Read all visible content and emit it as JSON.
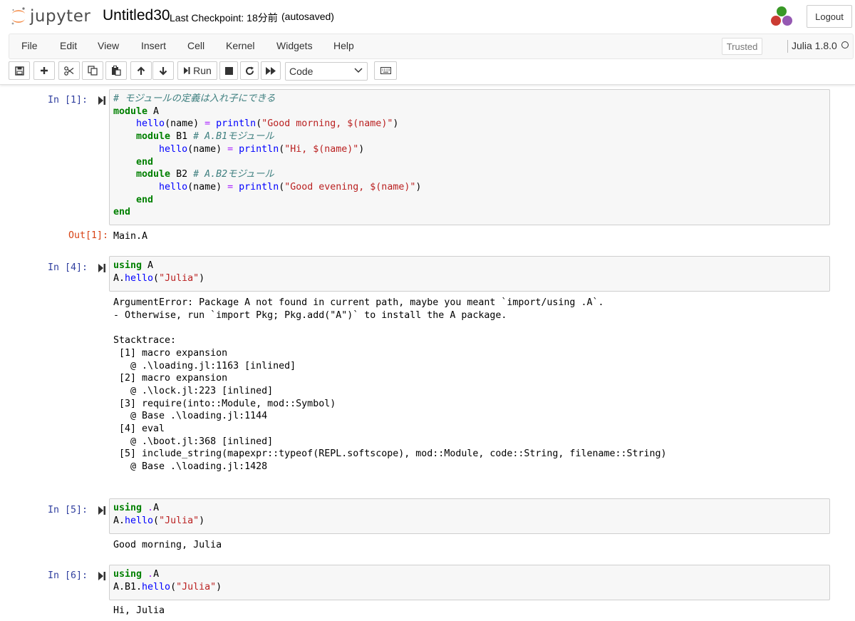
{
  "header": {
    "logo_text": "jupyter",
    "notebook_name": "Untitled30",
    "checkpoint": "Last Checkpoint: 18分前",
    "autosave": "(autosaved)",
    "logout_label": "Logout"
  },
  "menu": {
    "items": [
      "File",
      "Edit",
      "View",
      "Insert",
      "Cell",
      "Kernel",
      "Widgets",
      "Help"
    ],
    "trusted_label": "Trusted",
    "kernel_name": "Julia 1.8.0"
  },
  "toolbar": {
    "run_label": "Run",
    "cell_type": "Code",
    "buttons": [
      "save-icon",
      "plus-icon",
      "cut-icon",
      "copy-icon",
      "paste-icon",
      "arrow-up-icon",
      "arrow-down-icon",
      "run-icon",
      "stop-icon",
      "restart-icon",
      "fast-forward-icon",
      "keyboard-icon"
    ]
  },
  "cells": [
    {
      "prompt": "In [1]:",
      "code": [
        "# モジュールの定義は入れ子にできる",
        "module A",
        "    hello(name) = println(\"Good morning, $(name)\")",
        "    module B1 # A.B1モジュール",
        "        hello(name) = println(\"Hi, $(name)\")",
        "    end",
        "    module B2 # A.B2モジュール",
        "        hello(name) = println(\"Good evening, $(name)\")",
        "    end",
        "end"
      ],
      "out_prompt": "Out[1]:",
      "output": [
        "Main.A"
      ]
    },
    {
      "prompt": "In [4]:",
      "code": [
        "using A",
        "A.hello(\"Julia\")"
      ],
      "out_prompt": "",
      "output": [
        "ArgumentError: Package A not found in current path, maybe you meant `import/using .A`.",
        "- Otherwise, run `import Pkg; Pkg.add(\"A\")` to install the A package.",
        "",
        "Stacktrace:",
        " [1] macro expansion",
        "   @ .\\loading.jl:1163 [inlined]",
        " [2] macro expansion",
        "   @ .\\lock.jl:223 [inlined]",
        " [3] require(into::Module, mod::Symbol)",
        "   @ Base .\\loading.jl:1144",
        " [4] eval",
        "   @ .\\boot.jl:368 [inlined]",
        " [5] include_string(mapexpr::typeof(REPL.softscope), mod::Module, code::String, filename::String)",
        "   @ Base .\\loading.jl:1428"
      ]
    },
    {
      "prompt": "In [5]:",
      "code": [
        "using .A",
        "A.hello(\"Julia\")"
      ],
      "out_prompt": "",
      "output": [
        "Good morning, Julia"
      ]
    },
    {
      "prompt": "In [6]:",
      "code": [
        "using .A",
        "A.B1.hello(\"Julia\")"
      ],
      "out_prompt": "",
      "output": [
        "Hi, Julia"
      ]
    }
  ]
}
